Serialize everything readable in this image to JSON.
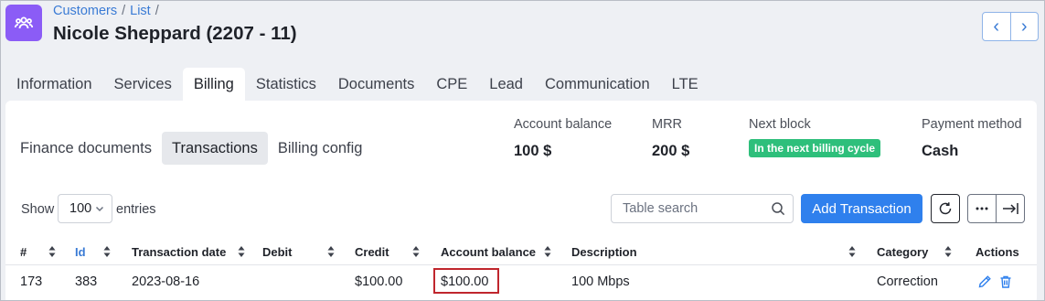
{
  "breadcrumb": {
    "customers": "Customers",
    "list": "List",
    "sep1": "/",
    "sep2": "/"
  },
  "page_title": "Nicole Sheppard (2207 - 11)",
  "nav": {
    "prev": "‹",
    "next": "›"
  },
  "tabs": [
    "Information",
    "Services",
    "Billing",
    "Statistics",
    "Documents",
    "CPE",
    "Lead",
    "Communication",
    "LTE"
  ],
  "active_tab": "Billing",
  "subtabs": [
    "Finance documents",
    "Transactions",
    "Billing config"
  ],
  "active_subtab": "Transactions",
  "stats": {
    "account_balance": {
      "label": "Account balance",
      "value": "100 $"
    },
    "mrr": {
      "label": "MRR",
      "value": "200 $"
    },
    "next_block": {
      "label": "Next block",
      "value": "In the next billing cycle"
    },
    "payment_method": {
      "label": "Payment method",
      "value": "Cash"
    }
  },
  "table_controls": {
    "show_label": "Show",
    "entries_value": "100",
    "entries_label": "entries",
    "search_placeholder": "Table search",
    "add_button": "Add Transaction"
  },
  "columns": [
    "#",
    "Id",
    "Transaction date",
    "Debit",
    "Credit",
    "Account balance",
    "Description",
    "Category",
    "Actions"
  ],
  "rows": [
    {
      "num": "173",
      "id": "383",
      "date": "2023-08-16",
      "debit": "",
      "credit": "$100.00",
      "balance": "$100.00",
      "description": "100 Mbps",
      "category": "Correction"
    }
  ],
  "colors": {
    "accent": "#2f80ed",
    "app_icon": "#8b5cf6",
    "badge": "#2ebf7b",
    "highlight": "#c0262d"
  },
  "icons": [
    "customers-icon",
    "chevron-left-icon",
    "chevron-right-icon",
    "chevron-down-icon",
    "search-icon",
    "refresh-icon",
    "more-icon",
    "export-icon",
    "sort-icon",
    "edit-icon",
    "trash-icon"
  ]
}
